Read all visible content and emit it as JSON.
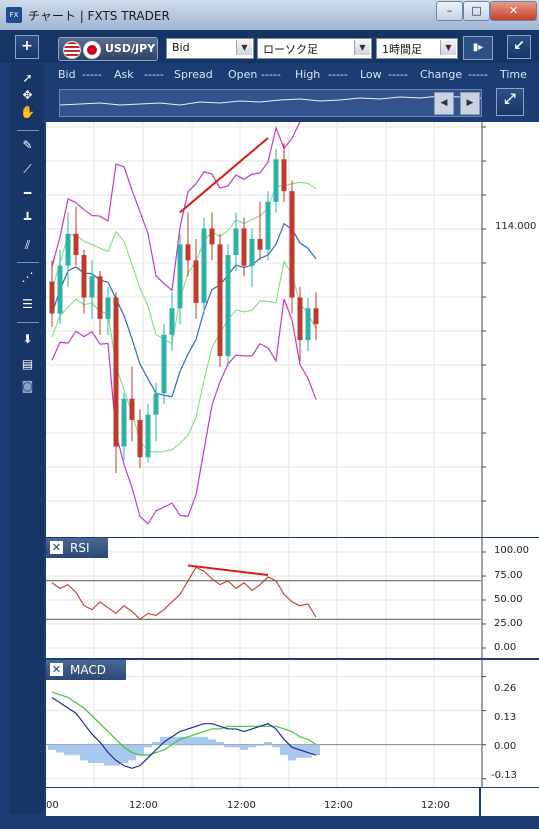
{
  "window": {
    "icon": "FX",
    "title": "チャート | FXTS TRADER",
    "min": "–",
    "max": "□",
    "close": "✕"
  },
  "toolbar": {
    "add": "+",
    "symbol": "USD/JPY",
    "price_type": "Bid",
    "chart_type": "ローソク足",
    "timeframe": "1時間足",
    "dock": "↙"
  },
  "quote_header": [
    "Bid",
    "-----",
    "Ask",
    "-----",
    "Spread",
    "Open",
    "-----",
    "High",
    "-----",
    "Low",
    "-----",
    "Change",
    "-----",
    "Time"
  ],
  "price_panel": {
    "y_label": "114.000"
  },
  "rsi_panel": {
    "title": "RSI",
    "y_labels": [
      "100.00",
      "75.00",
      "50.00",
      "25.00",
      "0.00"
    ]
  },
  "macd_panel": {
    "title": "MACD",
    "y_labels": [
      "0.26",
      "0.13",
      "0.00",
      "-0.13"
    ]
  },
  "x_axis": {
    "labels": [
      "00",
      "12:00",
      "12:00",
      "12:00",
      "12:00"
    ]
  },
  "colors": {
    "up": "#2bb3a9",
    "down": "#c0392b",
    "band_outer": "#c23bbf",
    "band_inner": "#7ee07e",
    "ma": "#2a6fb5",
    "trendline": "#d81b1b"
  },
  "chart_data": [
    {
      "type": "candlestick",
      "title": "USD/JPY",
      "ohlc": [
        [
          113.72,
          113.8,
          113.55,
          113.6
        ],
        [
          113.6,
          113.84,
          113.56,
          113.78
        ],
        [
          113.78,
          113.98,
          113.7,
          113.9
        ],
        [
          113.9,
          114.0,
          113.78,
          113.82
        ],
        [
          113.82,
          113.84,
          113.6,
          113.66
        ],
        [
          113.66,
          113.8,
          113.58,
          113.74
        ],
        [
          113.74,
          113.76,
          113.52,
          113.58
        ],
        [
          113.58,
          113.7,
          113.52,
          113.66
        ],
        [
          113.66,
          113.68,
          113.0,
          113.1
        ],
        [
          113.1,
          113.3,
          113.05,
          113.28
        ],
        [
          113.28,
          113.4,
          113.12,
          113.2
        ],
        [
          113.2,
          113.24,
          113.02,
          113.06
        ],
        [
          113.06,
          113.26,
          113.04,
          113.22
        ],
        [
          113.22,
          113.34,
          113.12,
          113.3
        ],
        [
          113.3,
          113.56,
          113.26,
          113.52
        ],
        [
          113.52,
          113.68,
          113.46,
          113.62
        ],
        [
          113.62,
          113.9,
          113.56,
          113.86
        ],
        [
          113.86,
          113.98,
          113.74,
          113.8
        ],
        [
          113.8,
          113.88,
          113.58,
          113.64
        ],
        [
          113.64,
          113.96,
          113.6,
          113.92
        ],
        [
          113.92,
          113.98,
          113.8,
          113.86
        ],
        [
          113.86,
          113.9,
          113.4,
          113.44
        ],
        [
          113.44,
          113.86,
          113.4,
          113.82
        ],
        [
          113.82,
          113.98,
          113.76,
          113.92
        ],
        [
          113.92,
          113.96,
          113.74,
          113.78
        ],
        [
          113.78,
          113.92,
          113.7,
          113.88
        ],
        [
          113.88,
          114.02,
          113.8,
          113.84
        ],
        [
          113.84,
          114.06,
          113.8,
          114.02
        ],
        [
          114.02,
          114.22,
          113.98,
          114.18
        ],
        [
          114.18,
          114.24,
          114.02,
          114.06
        ],
        [
          114.06,
          114.1,
          113.6,
          113.66
        ],
        [
          113.66,
          113.7,
          113.42,
          113.5
        ],
        [
          113.5,
          113.66,
          113.46,
          113.62
        ],
        [
          113.62,
          113.68,
          113.5,
          113.56
        ]
      ],
      "bands": {
        "upper": "bollinger",
        "lower": "bollinger"
      },
      "ylim": [
        112.76,
        114.32
      ]
    },
    {
      "type": "line",
      "title": "RSI",
      "values": [
        68,
        62,
        66,
        58,
        44,
        40,
        48,
        42,
        36,
        44,
        38,
        30,
        36,
        34,
        40,
        48,
        56,
        70,
        84,
        80,
        72,
        66,
        70,
        62,
        68,
        60,
        66,
        74,
        70,
        56,
        48,
        44,
        46,
        32
      ],
      "levels": [
        70,
        30
      ],
      "ylim": [
        0,
        100
      ]
    },
    {
      "type": "line",
      "title": "MACD",
      "series": [
        {
          "values": [
            0.18,
            0.16,
            0.14,
            0.12,
            0.08,
            0.04,
            0.01,
            -0.03,
            -0.06,
            -0.08,
            -0.09,
            -0.08,
            -0.05,
            -0.02,
            0.01,
            0.03,
            0.05,
            0.06,
            0.07,
            0.08,
            0.08,
            0.07,
            0.06,
            0.06,
            0.05,
            0.06,
            0.07,
            0.08,
            0.06,
            0.02,
            -0.01,
            -0.02,
            -0.03,
            -0.04
          ]
        },
        {
          "values": [
            0.2,
            0.19,
            0.18,
            0.16,
            0.14,
            0.11,
            0.08,
            0.05,
            0.02,
            -0.01,
            -0.03,
            -0.04,
            -0.04,
            -0.03,
            -0.02,
            0.0,
            0.02,
            0.03,
            0.04,
            0.05,
            0.06,
            0.06,
            0.07,
            0.07,
            0.07,
            0.07,
            0.07,
            0.07,
            0.07,
            0.06,
            0.05,
            0.03,
            0.02,
            0.0
          ]
        }
      ],
      "ylim": [
        -0.15,
        0.3
      ]
    }
  ]
}
